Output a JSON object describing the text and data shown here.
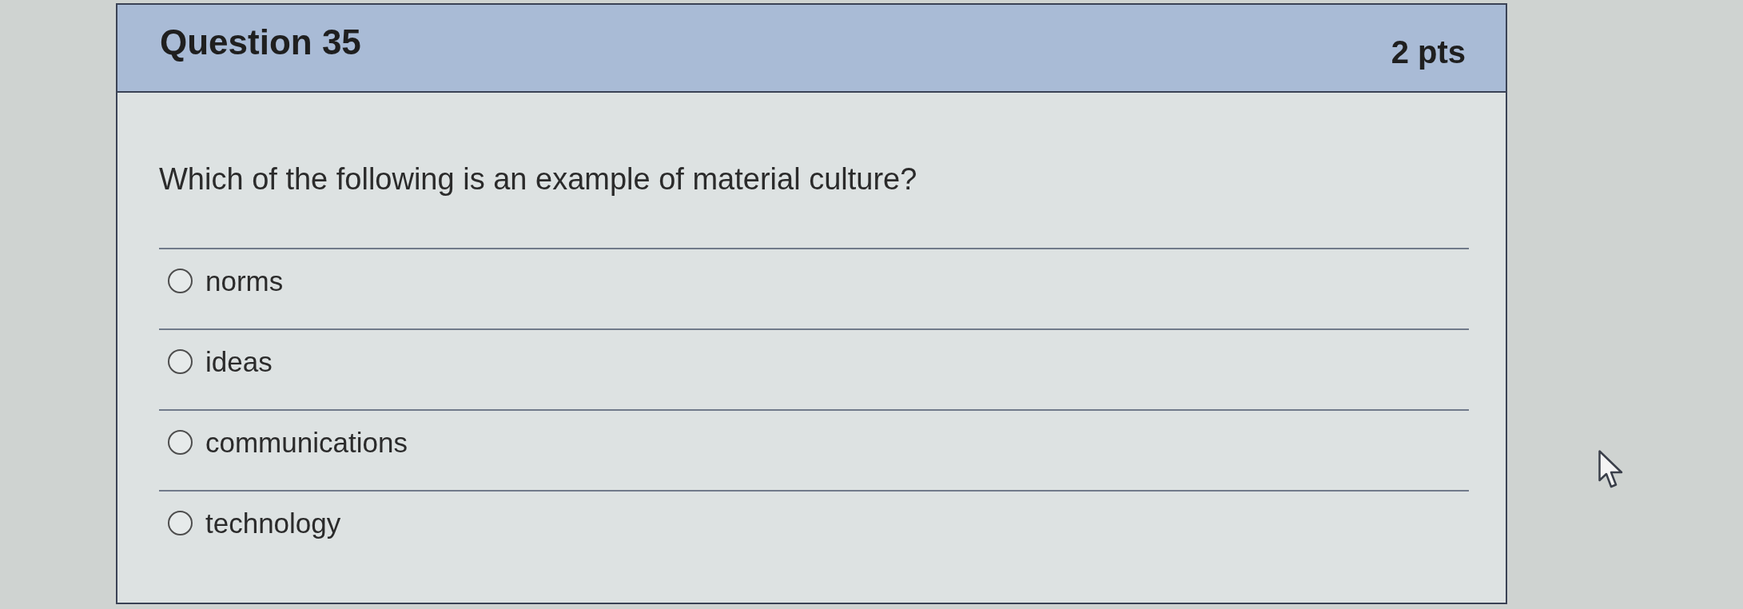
{
  "question": {
    "title": "Question 35",
    "points": "2 pts",
    "text": "Which of the following is an example of material culture?"
  },
  "options": [
    {
      "label": "norms",
      "selected": false
    },
    {
      "label": "ideas",
      "selected": false
    },
    {
      "label": "communications",
      "selected": false
    },
    {
      "label": "technology",
      "selected": false
    }
  ]
}
